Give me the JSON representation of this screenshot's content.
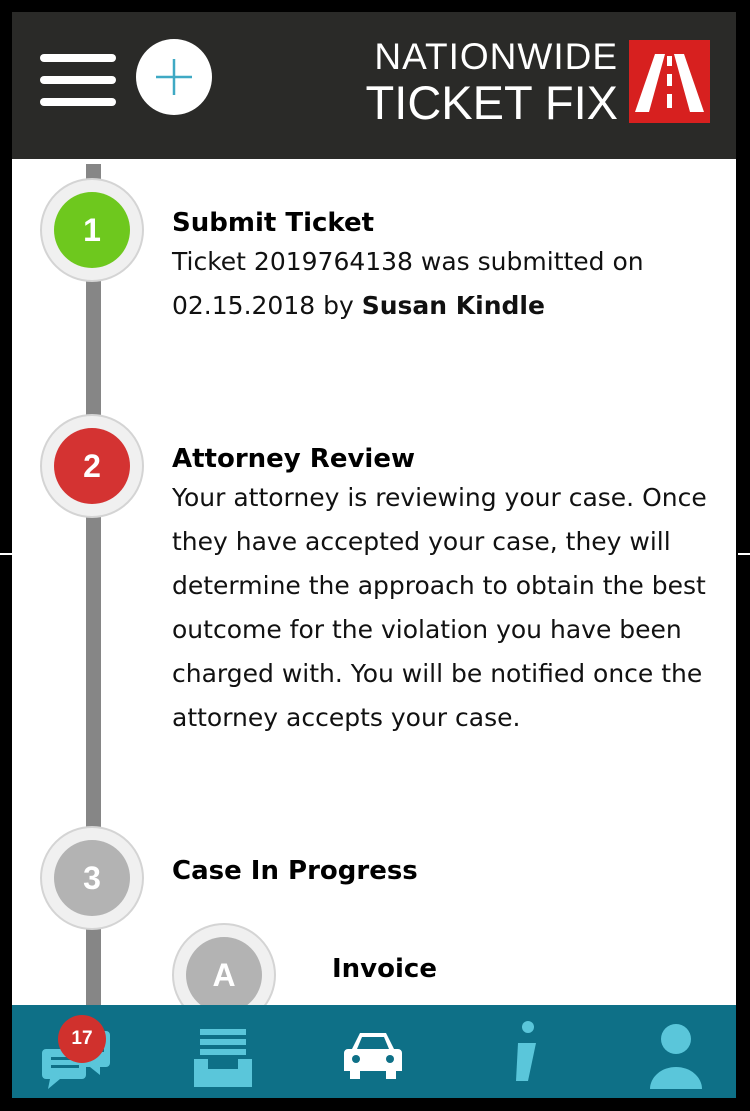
{
  "brand": {
    "line1": "NATIONWIDE",
    "line2": "TICKET FIX"
  },
  "icons": {
    "menu": "hamburger-icon",
    "add": "plus-icon",
    "logo": "road-icon",
    "nav_messages": "chat-icon",
    "nav_documents": "inbox-icon",
    "nav_vehicle": "car-icon",
    "nav_info": "info-icon",
    "nav_profile": "user-icon"
  },
  "colors": {
    "header_bg": "#2a2a28",
    "step_complete": "#6ec81e",
    "step_active": "#d43332",
    "step_pending": "#b3b3b3",
    "nav_bg": "#0e7087",
    "nav_icon": "#5ac6da",
    "badge": "#d0312d"
  },
  "steps": [
    {
      "number": "1",
      "title": "Submit Ticket",
      "body_prefix": "Ticket 2019764138 was submitted on 02.15.2018 by",
      "author": "Susan Kindle",
      "status": "complete"
    },
    {
      "number": "2",
      "title": "Attorney Review",
      "body": "Your attorney is reviewing your case. Once they have accepted your case, they will determine the approach to obtain the best outcome for the violation you have been charged with. You will be notified once the attorney accepts your case.",
      "status": "active"
    },
    {
      "number": "3",
      "title": "Case In Progress",
      "status": "pending",
      "substeps": [
        {
          "letter": "A",
          "title": "Invoice"
        }
      ]
    }
  ],
  "nav": {
    "messages_badge": "17"
  }
}
